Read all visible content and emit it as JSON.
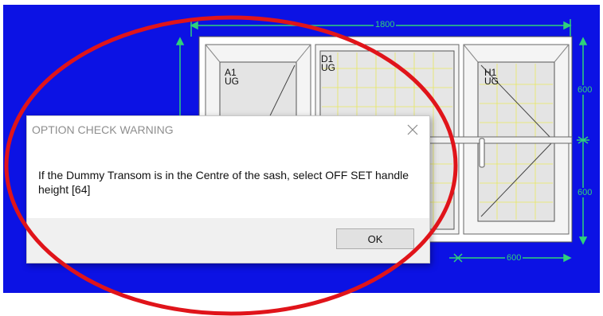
{
  "dimensions": {
    "overall_width": "1800",
    "right_top_height": "600",
    "right_bottom_height": "600",
    "bottom_width": "600"
  },
  "sashes": {
    "left": "A1\nUG",
    "middle": "D1\nUG",
    "right": "H1\nUG"
  },
  "dialog": {
    "title": "OPTION CHECK WARNING",
    "message": "If the Dummy Transom is in the Centre of the sash, select OFF SET handle height [64]",
    "ok_label": "OK"
  },
  "colors": {
    "canvas_background": "#0c12e4",
    "dimension_lines": "#2fd17a",
    "annotation_circle": "#e0141a"
  }
}
